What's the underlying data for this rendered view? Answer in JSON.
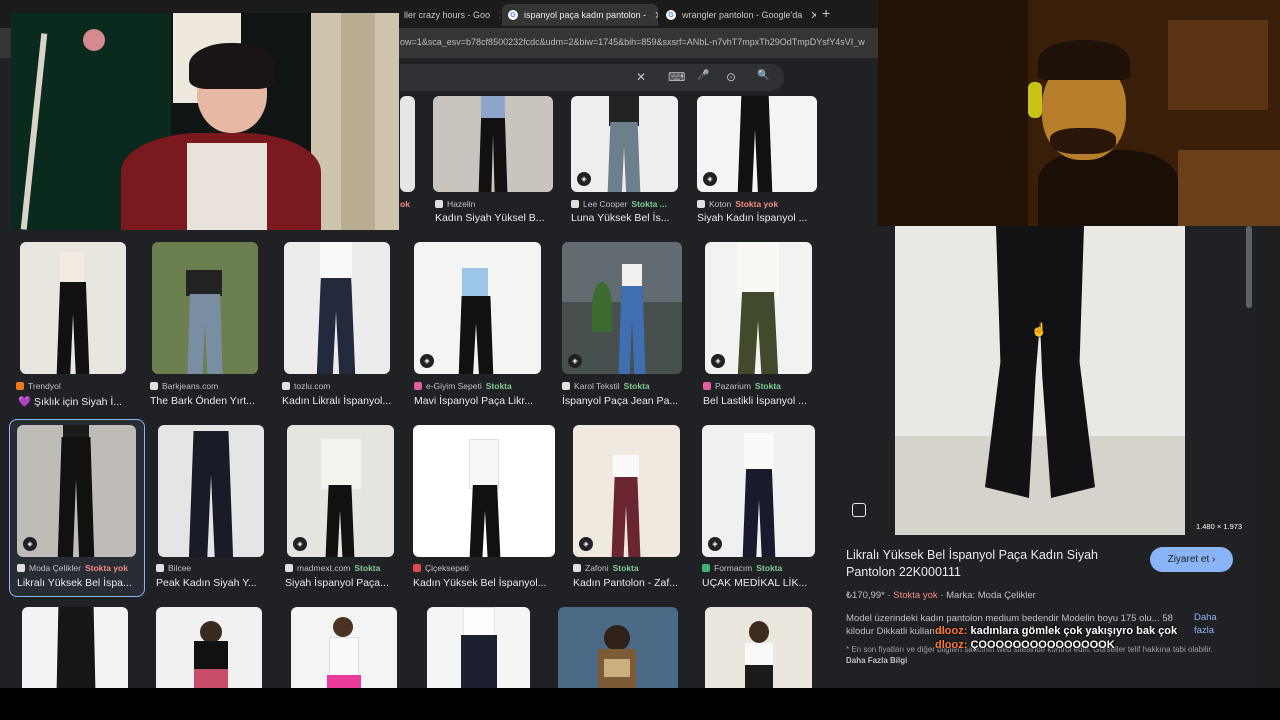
{
  "tabs": [
    {
      "label": "ller crazy hours - Goo",
      "active": false
    },
    {
      "label": "ispanyol paça kadın pantolon -",
      "active": true
    },
    {
      "label": "wrangler pantolon - Google'da",
      "active": false
    }
  ],
  "new_tab": "+",
  "url": "ow=1&sca_esv=b78cf8500232fcdc&udm=2&biw=1745&bih=859&sxsrf=ANbL-n7vhT7mpxTh29OdTmpDYsfY4sVI_w",
  "search": {
    "clear": "✕",
    "keyboard": "⌨",
    "mic": "🎤",
    "lens": "⊙",
    "search": "🔍"
  },
  "row0": [
    {
      "source": "",
      "status": "ok",
      "status_class": "nostock",
      "title": ""
    },
    {
      "source": "Hazelin",
      "status": "",
      "status_class": "",
      "title": "Kadın Siyah Yüksel B..."
    },
    {
      "source": "Lee Cooper",
      "status": "Stokta ...",
      "status_class": "stock",
      "title": "Luna Yüksek Bel İs..."
    },
    {
      "source": "Koton",
      "status": "Stokta yok",
      "status_class": "nostock",
      "title": "Siyah Kadın İspanyol ..."
    }
  ],
  "row1": [
    {
      "source": "Trendyol",
      "status": "",
      "status_class": "",
      "title": "💜 Şıklık için Siyah İ..."
    },
    {
      "source": "Barkjeans.com",
      "status": "",
      "status_class": "",
      "title": "The Bark Önden Yırt..."
    },
    {
      "source": "tozlu.com",
      "status": "",
      "status_class": "",
      "title": "Kadın Likralı İspanyol..."
    },
    {
      "source": "e-Giyim Sepeti",
      "status": "Stokta",
      "status_class": "stock",
      "title": "Mavi İspanyol Paça Likr..."
    },
    {
      "source": "Karol Tekstil",
      "status": "Stokta",
      "status_class": "stock",
      "title": "İspanyol Paça Jean Pa..."
    },
    {
      "source": "Pazarium",
      "status": "Stokta",
      "status_class": "stock",
      "title": "Bel Lastikli İspanyol ..."
    }
  ],
  "row2": [
    {
      "source": "Moda Çelikler",
      "status": "Stokta yok",
      "status_class": "nostock",
      "title": "Likralı Yüksek Bel İspa..."
    },
    {
      "source": "Bilcee",
      "status": "",
      "status_class": "",
      "title": "Peak Kadın Siyah Y..."
    },
    {
      "source": "madmext.com",
      "status": "Stokta",
      "status_class": "stock",
      "title": "Siyah İspanyol Paça..."
    },
    {
      "source": "Çiçeksepeti",
      "status": "",
      "status_class": "",
      "title": "Kadın Yüksek Bel İspanyol..."
    },
    {
      "source": "Zafoni",
      "status": "Stokta",
      "status_class": "stock",
      "title": "Kadın Pantolon - Zaf..."
    },
    {
      "source": "Formacım",
      "status": "Stokta",
      "status_class": "stock",
      "title": "UÇAK MEDİKAL LİK..."
    }
  ],
  "panel": {
    "dims": "1.480 × 1.973",
    "title": "Likralı Yüksek Bel İspanyol Paça Kadın Siyah Pantolon 22K000111",
    "visit": "Ziyaret et ›",
    "price": "₺170,99*",
    "stock": "Stokta yok",
    "brand": "Marka: Moda Çelikler",
    "desc": "Model üzerindeki kadın pantolon medium bedendir Modelin boyu 175 olu... 58 kilodur Dikkatli kullanım",
    "more": "Daha fazla",
    "note": "* En son fiyatları ve diğer bilgileri satıcının web sitesinde kontrol edin. Görseller telif hakkına tabi olabilir.",
    "note_link": "Daha Fazla Bilgi"
  },
  "chat": {
    "user1": "dlooz:",
    "msg1": "kadınlara gömlek çok yakışıyro bak çok",
    "user2": "dlooz:",
    "msg2": "ÇOOOOOOOOOOOOOOOK"
  }
}
